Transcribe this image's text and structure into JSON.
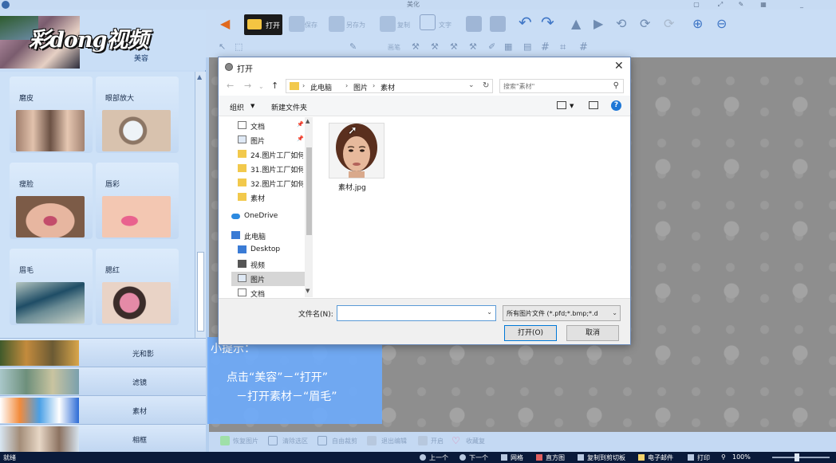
{
  "app": {
    "title": "美化",
    "logo_text": "彩dong视频"
  },
  "left_panel": {
    "category_title": "美容",
    "cards": [
      {
        "label": "磨皮"
      },
      {
        "label": "眼部放大"
      },
      {
        "label": "瘦脸"
      },
      {
        "label": "唇彩"
      },
      {
        "label": "眉毛"
      },
      {
        "label": "腮红"
      }
    ],
    "categories": [
      {
        "label": "光和影"
      },
      {
        "label": "滤镜"
      },
      {
        "label": "素材"
      },
      {
        "label": "相框"
      }
    ]
  },
  "toolbar": {
    "open_label": "打开",
    "save_label": "保存",
    "saveas_label": "另存为",
    "copy_label": "复制",
    "text_label": "文字",
    "pen_label": "画笔"
  },
  "dialog": {
    "title": "打开",
    "breadcrumbs": [
      "此电脑",
      "图片",
      "素材"
    ],
    "search_placeholder": "搜索\"素材\"",
    "organize": "组织",
    "new_folder": "新建文件夹",
    "nav_items": [
      "文档",
      "图片",
      "24.图片工厂如何",
      "31.图片工厂如何",
      "32.图片工厂如何",
      "素材",
      "OneDrive",
      "此电脑",
      "Desktop",
      "视频",
      "图片",
      "文档"
    ],
    "file_name": "素材.jpg",
    "filename_label": "文件名(N):",
    "filename_value": "",
    "filetype_value": "所有图片文件 (*.pfd;*.bmp;*.d",
    "open_button": "打开(O)",
    "cancel_button": "取消"
  },
  "tip": {
    "heading": "小提示：",
    "line1": "点击“美容”－“打开”",
    "line2": "－打开素材－“眉毛”"
  },
  "bottom_toolbar": [
    "恢复图片",
    "清除选区",
    "自由裁剪",
    "退出编辑",
    "开启",
    "收藏复"
  ],
  "status": {
    "left": "就绪",
    "items": [
      "上一个",
      "下一个",
      "网格",
      "直方图",
      "复制到剪切板",
      "电子邮件",
      "打印"
    ],
    "zoom": "100%"
  }
}
